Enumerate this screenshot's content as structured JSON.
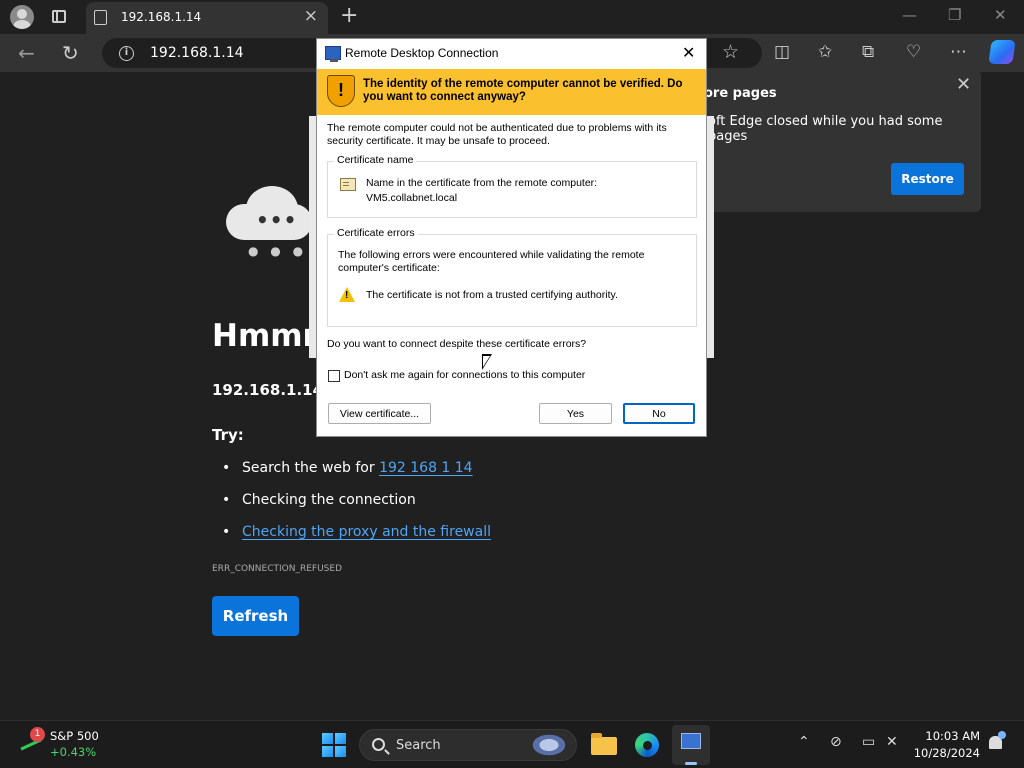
{
  "browser": {
    "tab_title": "192.168.1.14",
    "new_tab": "+",
    "address": "192.168.1.14",
    "window_controls": {
      "minimize": "—",
      "restore": "❐",
      "close": "✕"
    }
  },
  "page": {
    "heading": "Hmmm",
    "host": "192.168.1.14",
    "try_label": "Try:",
    "suggestions": [
      {
        "prefix": "Search the web for ",
        "link": "192 168 1 14"
      },
      {
        "prefix": "Checking the connection",
        "link": ""
      },
      {
        "prefix": "",
        "link": "Checking the proxy and the firewall"
      }
    ],
    "error_code": "ERR_CONNECTION_REFUSED",
    "refresh_label": "Refresh"
  },
  "restore_popup": {
    "title": "ore pages",
    "text": "oft Edge closed while you had some pages",
    "button": "Restore"
  },
  "dialog": {
    "title": "Remote Desktop Connection",
    "warning": "The identity of the remote computer cannot be verified. Do you want to connect anyway?",
    "intro": "The remote computer could not be authenticated due to problems with its security certificate. It may be unsafe to proceed.",
    "cert_name_label": "Certificate name",
    "cert_name_line1": "Name in the certificate from the remote computer:",
    "cert_name_line2": "VM5.collabnet.local",
    "cert_errors_label": "Certificate errors",
    "cert_errors_text": "The following errors were encountered while validating the remote computer's certificate:",
    "cert_error_item": "The certificate is not from a trusted certifying authority.",
    "question": "Do you want to connect despite these certificate errors?",
    "dont_ask": "Don't ask me again for connections to this computer",
    "buttons": {
      "view": "View certificate...",
      "yes": "Yes",
      "no": "No"
    }
  },
  "taskbar": {
    "stock_badge": "1",
    "stock_name": "S&P 500",
    "stock_change": "+0.43%",
    "search_label": "Search",
    "time": "10:03 AM",
    "date": "10/28/2024"
  },
  "colors": {
    "accent_blue": "#0a74da",
    "link_blue": "#4ea5f5",
    "warning_band": "#fbc02d",
    "stock_green": "#48d36f"
  }
}
